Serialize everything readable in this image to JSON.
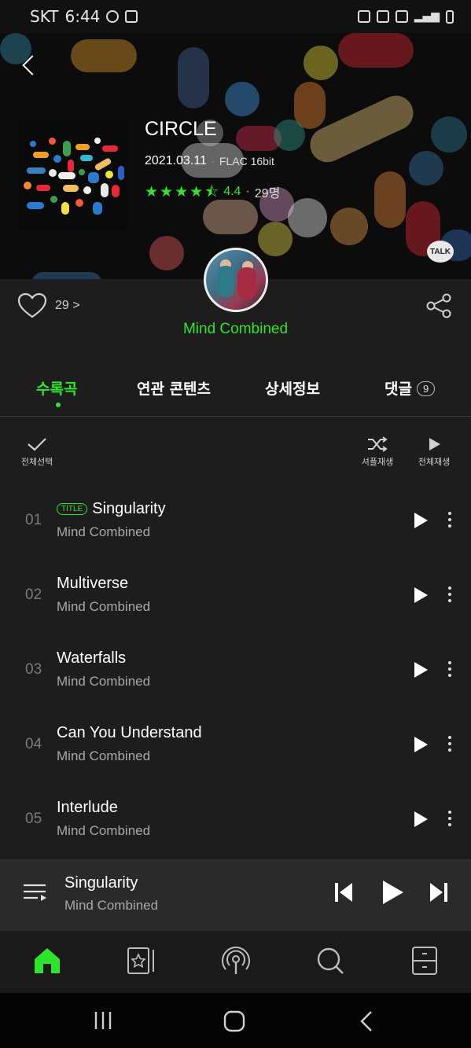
{
  "status_bar": {
    "carrier": "SKT",
    "time": "6:44"
  },
  "album": {
    "title": "CIRCLE",
    "date": "2021.03.11",
    "format": "FLAC 16bit",
    "rating": "4.4",
    "rating_count": "29명",
    "talk_label": "TALK"
  },
  "artist": {
    "name": "Mind Combined"
  },
  "likes": {
    "count": "29 >"
  },
  "tabs": [
    {
      "label": "수록곡",
      "active": true
    },
    {
      "label": "연관 콘텐츠",
      "active": false
    },
    {
      "label": "상세정보",
      "active": false
    },
    {
      "label": "댓글",
      "badge": "9",
      "active": false
    }
  ],
  "actions": {
    "select_all": "전체선택",
    "shuffle": "셔플재생",
    "play_all": "전체재생"
  },
  "tracks": [
    {
      "num": "01",
      "title": "Singularity",
      "badge": "TITLE",
      "artist": "Mind Combined"
    },
    {
      "num": "02",
      "title": "Multiverse",
      "artist": "Mind Combined"
    },
    {
      "num": "03",
      "title": "Waterfalls",
      "artist": "Mind Combined"
    },
    {
      "num": "04",
      "title": "Can You Understand",
      "artist": "Mind Combined"
    },
    {
      "num": "05",
      "title": "Interlude",
      "artist": "Mind Combined"
    }
  ],
  "now_playing": {
    "title": "Singularity",
    "artist": "Mind Combined"
  },
  "nav": [
    "home-icon",
    "library-icon",
    "podcast-icon",
    "search-icon",
    "mymenu-icon"
  ],
  "colors": {
    "accent": "#2ee52e",
    "background": "#1d1d1d"
  }
}
